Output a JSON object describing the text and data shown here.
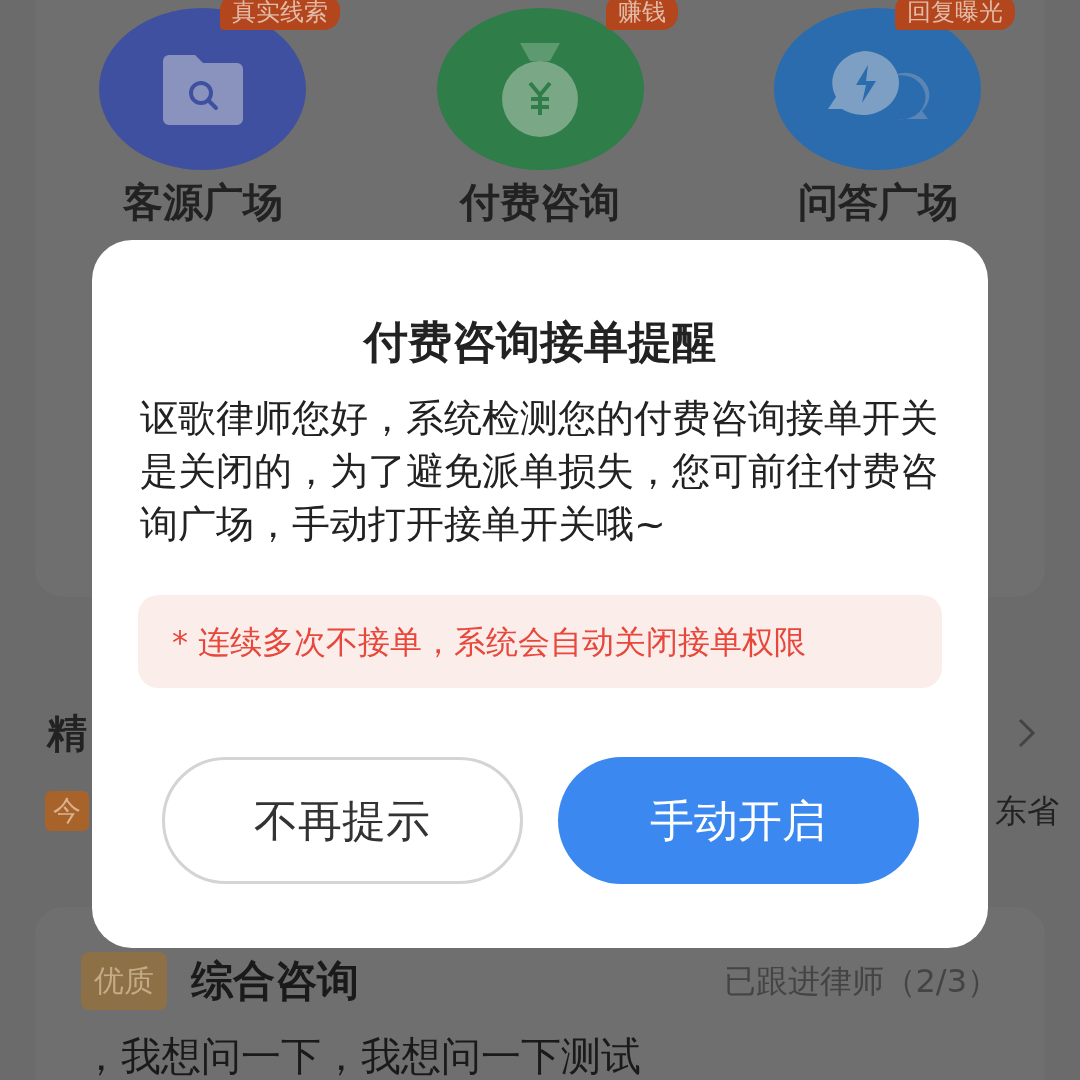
{
  "entries": [
    {
      "kind": "folder",
      "badge": "真实线索",
      "label": "客源广场"
    },
    {
      "kind": "money",
      "badge": "赚钱",
      "label": "付费咨询"
    },
    {
      "kind": "chat",
      "badge": "回复曝光",
      "label": "问答广场"
    }
  ],
  "section": {
    "title": "精",
    "tag": "今",
    "location": "东省"
  },
  "card": {
    "badge": "优质",
    "title": "综合咨询",
    "status": "已跟进律师（2/3）",
    "text": "，我想问一下，我想问一下测试"
  },
  "dialog": {
    "title": "付费咨询接单提醒",
    "message": "讴歌律师您好，系统检测您的付费咨询接单开关是关闭的，为了避免派单损失，您可前往付费咨询广场，手动打开接单开关哦~",
    "warning": "* 连续多次不接单，系统会自动关闭接单权限",
    "buttons": [
      {
        "label": "不再提示",
        "kind": "secondary"
      },
      {
        "label": "手动开启",
        "kind": "primary"
      }
    ]
  }
}
